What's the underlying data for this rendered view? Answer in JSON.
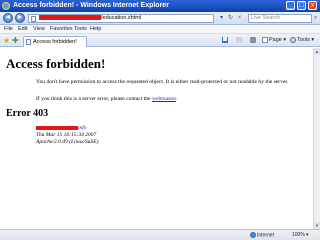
{
  "window": {
    "title_prefix": "Access forbidden! -",
    "title_app": "Windows Internet Explorer",
    "minimize": "_",
    "maximize": "□",
    "close": "x"
  },
  "address_bar": {
    "url_suffix": "/education.shtml",
    "back": "◄",
    "forward": "►",
    "refresh": "↻",
    "stop": "×",
    "search_placeholder": "Live Search",
    "search_button": "⌕"
  },
  "menu": [
    "File",
    "Edit",
    "View",
    "Favorites",
    "Tools",
    "Help"
  ],
  "tabbar": {
    "tab_label": "Access forbidden!",
    "page_label": "Page",
    "tools_label": "Tools"
  },
  "content": {
    "heading": "Access forbidden!",
    "message1": "You don't have permission to access the requested object. It is either read-protected or not readable by the server.",
    "message2_prefix": "If you think this is a server error, please contact the",
    "message2_link": "webmaster",
    "message2_suffix": ".",
    "error_heading": "Error 403",
    "host_suffix": "info",
    "timestamp": "Thu Mar 15 16:15:34 2007",
    "server": "Apache/2.0.49 (Linux/SuSE)"
  },
  "statusbar": {
    "zone": "Internet",
    "zoom": "100%"
  },
  "colors": {
    "titlebar": "#1a4fc0",
    "link": "#1c2bc8",
    "redaction": "#e01818"
  }
}
